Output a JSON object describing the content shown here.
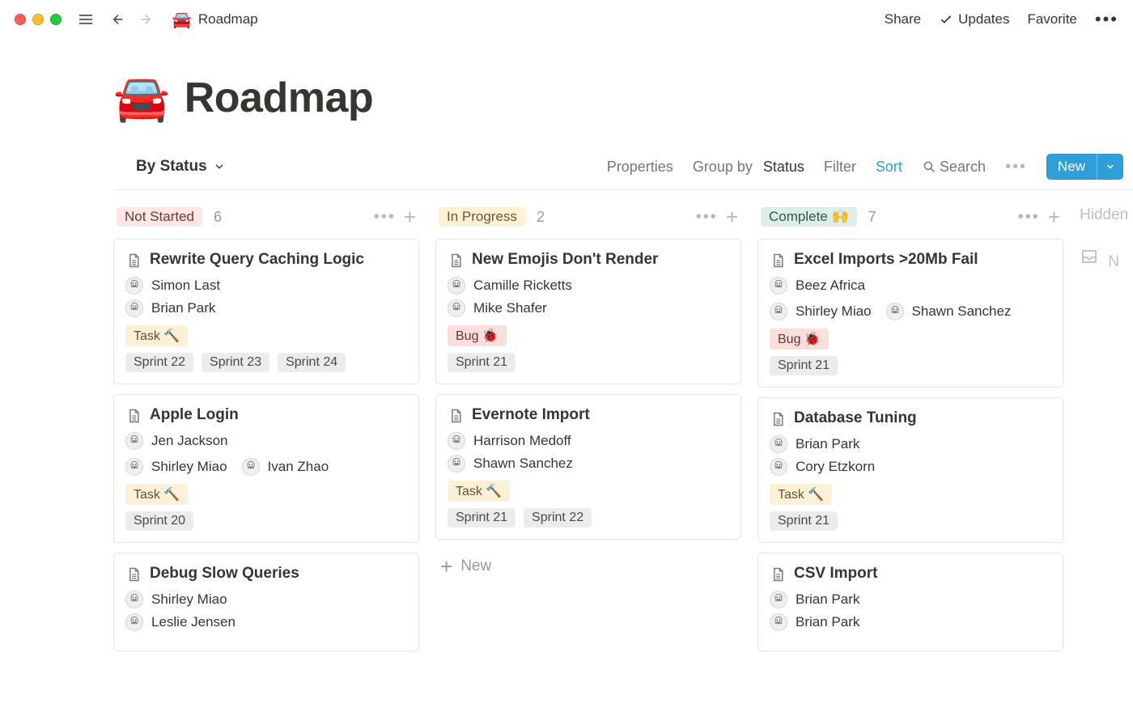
{
  "topbar": {
    "breadcrumb_title": "Roadmap",
    "breadcrumb_emoji": "🚘",
    "share": "Share",
    "updates": "Updates",
    "favorite": "Favorite"
  },
  "page": {
    "emoji": "🚘",
    "title": "Roadmap"
  },
  "view": {
    "name": "By Status",
    "properties": "Properties",
    "groupby_prefix": "Group by",
    "groupby_value": "Status",
    "filter": "Filter",
    "sort": "Sort",
    "search": "Search",
    "new": "New"
  },
  "hidden_label": "Hidden",
  "columns": [
    {
      "title": "Not Started",
      "count": "6",
      "status_class": "status-notstarted",
      "cards": [
        {
          "title": "Rewrite Query Caching Logic",
          "assignees": [
            {
              "name": "Simon Last"
            },
            {
              "name": "Brian Park"
            }
          ],
          "type_tag": {
            "label": "Task 🔨",
            "class": "tag-task"
          },
          "sprints": [
            "Sprint 22",
            "Sprint 23",
            "Sprint 24"
          ]
        },
        {
          "title": "Apple Login",
          "assignees": [
            {
              "name": "Jen Jackson"
            }
          ],
          "assignees_row2": [
            {
              "name": "Shirley Miao"
            },
            {
              "name": "Ivan Zhao"
            }
          ],
          "type_tag": {
            "label": "Task 🔨",
            "class": "tag-task"
          },
          "sprints": [
            "Sprint 20"
          ]
        },
        {
          "title": "Debug Slow Queries",
          "assignees": [
            {
              "name": "Shirley Miao"
            },
            {
              "name": "Leslie Jensen"
            }
          ]
        }
      ]
    },
    {
      "title": "In Progress",
      "count": "2",
      "status_class": "status-inprogress",
      "cards": [
        {
          "title": "New Emojis Don't Render",
          "assignees": [
            {
              "name": "Camille Ricketts"
            },
            {
              "name": "Mike Shafer"
            }
          ],
          "type_tag": {
            "label": "Bug 🐞",
            "class": "tag-bug"
          },
          "sprints": [
            "Sprint 21"
          ]
        },
        {
          "title": "Evernote Import",
          "assignees": [
            {
              "name": "Harrison Medoff"
            },
            {
              "name": "Shawn Sanchez"
            }
          ],
          "type_tag": {
            "label": "Task 🔨",
            "class": "tag-task"
          },
          "sprints": [
            "Sprint 21",
            "Sprint 22"
          ]
        }
      ],
      "add_new": "New"
    },
    {
      "title": "Complete 🙌",
      "count": "7",
      "status_class": "status-complete",
      "cards": [
        {
          "title": "Excel Imports >20Mb Fail",
          "assignees": [
            {
              "name": "Beez Africa"
            }
          ],
          "assignees_row2": [
            {
              "name": "Shirley Miao"
            },
            {
              "name": "Shawn Sanchez"
            }
          ],
          "type_tag": {
            "label": "Bug 🐞",
            "class": "tag-bug"
          },
          "sprints": [
            "Sprint 21"
          ]
        },
        {
          "title": "Database Tuning",
          "assignees": [
            {
              "name": "Brian Park"
            },
            {
              "name": "Cory Etzkorn"
            }
          ],
          "type_tag": {
            "label": "Task 🔨",
            "class": "tag-task"
          },
          "sprints": [
            "Sprint 21"
          ]
        },
        {
          "title": "CSV Import",
          "assignees": [
            {
              "name": "Brian Park"
            },
            {
              "name": "Brian Park"
            }
          ]
        }
      ]
    }
  ]
}
